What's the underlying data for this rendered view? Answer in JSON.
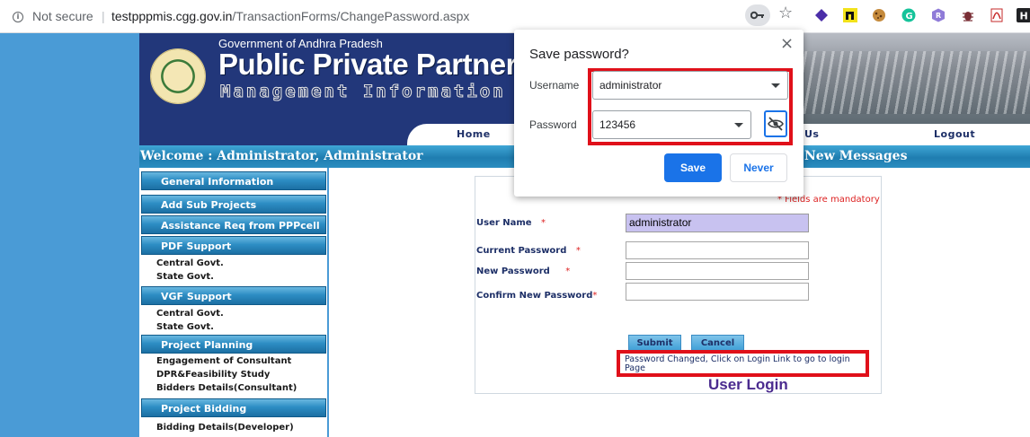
{
  "browser": {
    "security_label": "Not secure",
    "separator": "|",
    "url_host": "testpppmis.cgg.gov.in",
    "url_path": "/TransactionForms/ChangePassword.aspx"
  },
  "banner": {
    "government": "Government of Andhra Pradesh",
    "title": "Public Private Partners",
    "subtitle": "Management Information Sy"
  },
  "nav": {
    "home": "Home",
    "us": "Us",
    "logout": "Logout"
  },
  "welcome": "Welcome : Administrator, Administrator",
  "new_messages": "New Messages",
  "sidebar": {
    "general_information": "General Information",
    "add_sub_projects": "Add Sub Projects",
    "assistance_req": "Assistance Req from PPPcell",
    "pdf_support": "PDF Support",
    "pdf_items": [
      "Central Govt.",
      "State Govt."
    ],
    "vgf_support": "VGF Support",
    "vgf_items": [
      "Central Govt.",
      "State Govt."
    ],
    "project_planning": "Project Planning",
    "planning_items": [
      "Engagement of Consultant",
      "DPR&Feasibility Study",
      "Bidders Details(Consultant)"
    ],
    "project_bidding": "Project Bidding",
    "bidding_items": [
      "Bidding Details(Developer)"
    ]
  },
  "form": {
    "mandatory_note": "* Fields are mandatory",
    "user_name_label": "User Name",
    "user_name_value": "administrator",
    "current_password_label": "Current Password",
    "new_password_label": "New Password",
    "confirm_password_label": "Confirm New Password",
    "required_mark": "*",
    "submit": "Submit",
    "cancel": "Cancel",
    "message": "Password Changed, Click on Login Link to go to login Page",
    "user_login": "User Login"
  },
  "popup": {
    "title": "Save password?",
    "close": "×",
    "username_label": "Username",
    "username_value": "administrator",
    "password_label": "Password",
    "password_value": "123456",
    "save": "Save",
    "never": "Never"
  },
  "colors": {
    "accent": "#1a73e8",
    "highlight_frame": "#e0101a",
    "header_navy": "#22377a",
    "page_blue": "#4a9bd6"
  }
}
